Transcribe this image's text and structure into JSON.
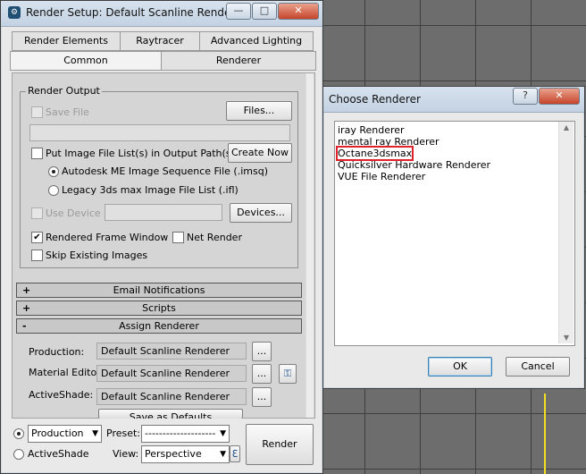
{
  "render_setup": {
    "title": "Render Setup: Default Scanline Renderer",
    "app_icon": "3ds-max-logo-icon",
    "window_buttons": {
      "minimize": "—",
      "maximize": "□",
      "close": "✕"
    },
    "tabs_row1": [
      "Render Elements",
      "Raytracer",
      "Advanced Lighting"
    ],
    "tabs_row2": [
      "Common",
      "Renderer"
    ],
    "active_tab": "Common",
    "render_output": {
      "group_label": "Render Output",
      "save_file_label": "Save File",
      "files_button": "Files...",
      "put_image_label": "Put Image File List(s) in Output Path(s)",
      "create_now_button": "Create Now",
      "autodesk_radio_label": "Autodesk ME Image Sequence File (.imsq)",
      "legacy_radio_label": "Legacy 3ds max Image File List (.ifl)",
      "use_device_label": "Use Device",
      "devices_button": "Devices...",
      "rendered_frame_window_label": "Rendered Frame Window",
      "net_render_label": "Net Render",
      "skip_existing_label": "Skip Existing Images"
    },
    "rollouts": [
      {
        "sign": "+",
        "label": "Email Notifications"
      },
      {
        "sign": "+",
        "label": "Scripts"
      },
      {
        "sign": "-",
        "label": "Assign Renderer"
      }
    ],
    "assign": {
      "production_label": "Production:",
      "production_value": "Default Scanline Renderer",
      "material_label": "Material Editor:",
      "material_value": "Default Scanline Renderer",
      "activeshade_label": "ActiveShade:",
      "activeshade_value": "Default Scanline Renderer",
      "browse_button": "...",
      "save_defaults_button": "Save as Defaults"
    },
    "bottom": {
      "mode_production": "Production",
      "mode_activeshade": "ActiveShade",
      "preset_label": "Preset:",
      "preset_value": "--------------------",
      "view_label": "View:",
      "view_value": "Perspective",
      "render_button": "Render"
    }
  },
  "choose_renderer": {
    "title": "Choose Renderer",
    "help_button": "?",
    "close_button": "✕",
    "items": [
      "iray Renderer",
      "mental ray Renderer",
      "Octane3dsmax",
      "Quicksilver Hardware Renderer",
      "VUE File Renderer"
    ],
    "highlighted_item": "Octane3dsmax",
    "ok_button": "OK",
    "cancel_button": "Cancel"
  },
  "colors": {
    "highlight_outline": "#e0202a",
    "viewport_active_axis": "#f0e020"
  }
}
